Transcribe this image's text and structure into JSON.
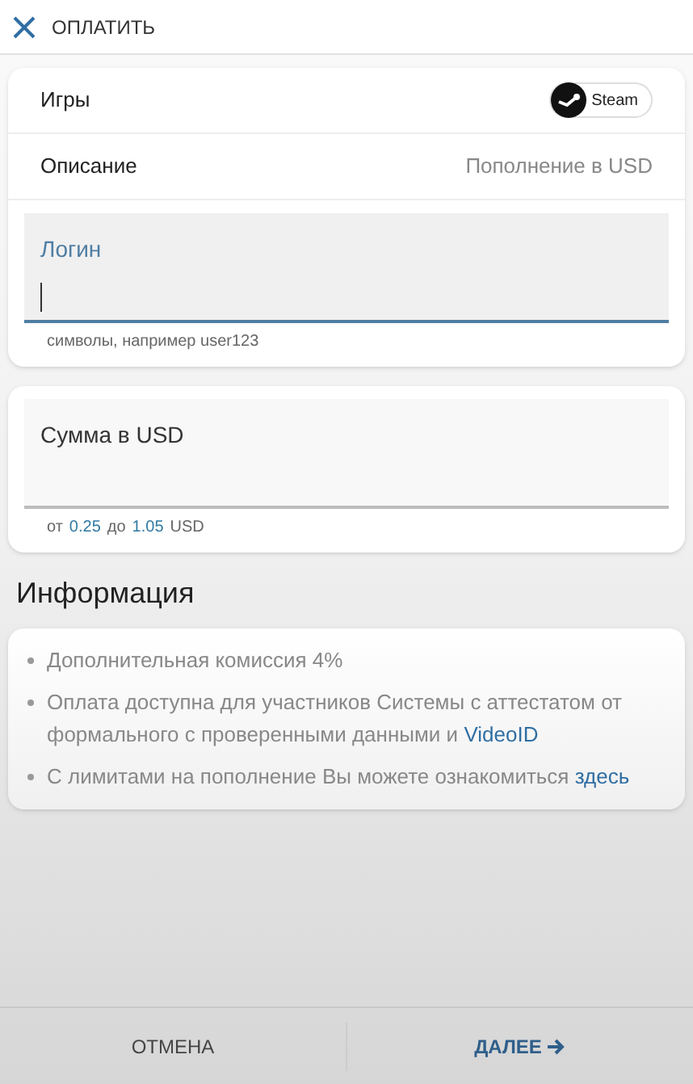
{
  "header": {
    "title": "ОПЛАТИТЬ"
  },
  "details": [
    {
      "kind": "badge",
      "label": "Игры",
      "value": "Steam"
    },
    {
      "kind": "text",
      "label": "Описание",
      "value": "Пополнение в USD"
    }
  ],
  "login": {
    "label": "Логин",
    "focused": true,
    "hint": "символы, например user123"
  },
  "amount": {
    "label": "Сумма в USD",
    "focused": false,
    "hint": [
      {
        "kind": "text",
        "text": "от"
      },
      {
        "kind": "value",
        "text": "0.25"
      },
      {
        "kind": "text",
        "text": "до"
      },
      {
        "kind": "value",
        "text": "1.05"
      },
      {
        "kind": "text",
        "text": "USD"
      }
    ]
  },
  "info": {
    "title": "Информация",
    "items": [
      [
        {
          "kind": "text",
          "text": "Дополнительная комиссия 4%"
        }
      ],
      [
        {
          "kind": "text",
          "text": "Оплата доступна для участников Системы с аттестатом от формального с проверенными данными и"
        },
        {
          "kind": "link",
          "text": "VideoID"
        }
      ],
      [
        {
          "kind": "text",
          "text": "С лимитами на пополнение Вы можете ознакомиться"
        },
        {
          "kind": "link",
          "text": "здесь"
        }
      ]
    ]
  },
  "footer": {
    "cancel": "ОТМЕНА",
    "next": "ДАЛЕЕ"
  }
}
